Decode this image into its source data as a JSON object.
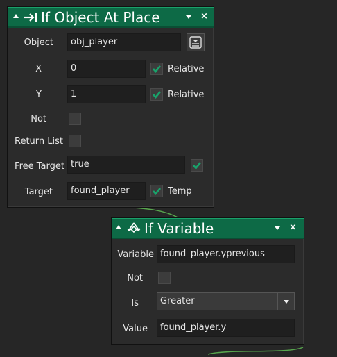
{
  "colors": {
    "header": "#0d6a46",
    "check": "#19a36b",
    "canvas": "#262626",
    "panel": "#2b2b2b"
  },
  "panel1": {
    "title": "If Object At Place",
    "icons": {
      "collapse": "triangle-up-icon",
      "action": "arrow-to-bar-icon",
      "menu": "dropdown-icon",
      "close": "close-icon",
      "pick": "object-picker-icon"
    },
    "close_glyph": "×",
    "fields": {
      "object": {
        "label": "Object",
        "value": "obj_player"
      },
      "x": {
        "label": "X",
        "value": "0",
        "relative_label": "Relative",
        "relative_checked": true
      },
      "y": {
        "label": "Y",
        "value": "1",
        "relative_label": "Relative",
        "relative_checked": true
      },
      "not": {
        "label": "Not",
        "checked": false
      },
      "return_list": {
        "label": "Return List",
        "checked": false
      },
      "free_target": {
        "label": "Free Target",
        "value": "true",
        "checked": true
      },
      "target": {
        "label": "Target",
        "value": "found_player",
        "temp_label": "Temp",
        "temp_checked": true
      }
    }
  },
  "panel2": {
    "title": "If Variable",
    "icons": {
      "collapse": "triangle-up-icon",
      "action": "branch-icon",
      "menu": "dropdown-icon",
      "close": "close-icon"
    },
    "close_glyph": "×",
    "fields": {
      "variable": {
        "label": "Variable",
        "value": "found_player.yprevious"
      },
      "not": {
        "label": "Not",
        "checked": false
      },
      "is": {
        "label": "Is",
        "value": "Greater"
      },
      "value": {
        "label": "Value",
        "value": "found_player.y"
      }
    }
  }
}
